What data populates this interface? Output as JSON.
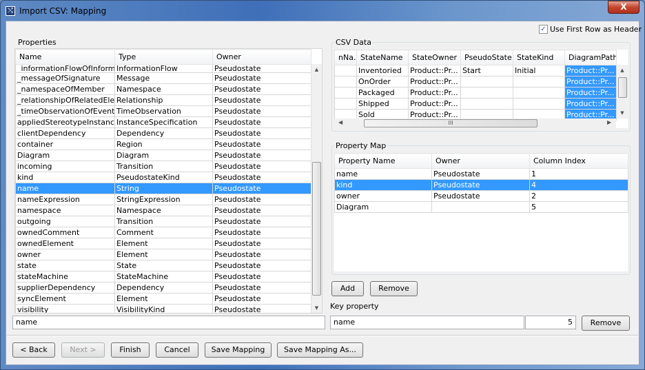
{
  "window": {
    "title": "Import CSV: Mapping",
    "close_label": "X"
  },
  "use_first_row": {
    "label": "Use First Row as Header",
    "checked": true
  },
  "properties": {
    "title": "Properties",
    "columns": [
      "Name",
      "Type",
      "Owner"
    ],
    "rows": [
      [
        "_informationFlowOfInform...",
        "InformationFlow",
        "Pseudostate"
      ],
      [
        "_messageOfSignature",
        "Message",
        "Pseudostate"
      ],
      [
        "_namespaceOfMember",
        "Namespace",
        "Pseudostate"
      ],
      [
        "_relationshipOfRelatedEle...",
        "Relationship",
        "Pseudostate"
      ],
      [
        "_timeObservationOfEvent",
        "TimeObservation",
        "Pseudostate"
      ],
      [
        "appliedStereotypeInstance",
        "InstanceSpecification",
        "Pseudostate"
      ],
      [
        "clientDependency",
        "Dependency",
        "Pseudostate"
      ],
      [
        "container",
        "Region",
        "Pseudostate"
      ],
      [
        "Diagram",
        "Diagram",
        "Pseudostate"
      ],
      [
        "incoming",
        "Transition",
        "Pseudostate"
      ],
      [
        "kind",
        "PseudostateKind",
        "Pseudostate"
      ],
      [
        "name",
        "String",
        "Pseudostate"
      ],
      [
        "nameExpression",
        "StringExpression",
        "Pseudostate"
      ],
      [
        "namespace",
        "Namespace",
        "Pseudostate"
      ],
      [
        "outgoing",
        "Transition",
        "Pseudostate"
      ],
      [
        "ownedComment",
        "Comment",
        "Pseudostate"
      ],
      [
        "ownedElement",
        "Element",
        "Pseudostate"
      ],
      [
        "owner",
        "Element",
        "Pseudostate"
      ],
      [
        "state",
        "State",
        "Pseudostate"
      ],
      [
        "stateMachine",
        "StateMachine",
        "Pseudostate"
      ],
      [
        "supplierDependency",
        "Dependency",
        "Pseudostate"
      ],
      [
        "syncElement",
        "Element",
        "Pseudostate"
      ],
      [
        "visibility",
        "VisibilityKind",
        "Pseudostate"
      ]
    ],
    "selected_index": 11,
    "filter_value": "name"
  },
  "csv": {
    "title": "CSV Data",
    "columns": [
      "nNa...",
      "StateName",
      "StateOwner",
      "PseudoState",
      "StateKind",
      "DiagramPath"
    ],
    "rows": [
      [
        "",
        "Inventoried",
        "Product::Pr...",
        "Start",
        "Initial",
        "Product::Pr..."
      ],
      [
        "",
        "OnOrder",
        "Product::Pr...",
        "",
        "",
        "Product::Pr..."
      ],
      [
        "",
        "Packaged",
        "Product::Pr...",
        "",
        "",
        "Product::Pr..."
      ],
      [
        "",
        "Shipped",
        "Product::Pr...",
        "",
        "",
        "Product::Pr..."
      ],
      [
        "",
        "Sold",
        "Product::Pr...",
        "",
        "",
        "Product::Pr..."
      ]
    ],
    "highlighted_column": 5,
    "hscroll_grip": "III"
  },
  "property_map": {
    "title": "Property Map",
    "columns": [
      "Property Name",
      "Owner",
      "Column Index"
    ],
    "rows": [
      [
        "name",
        "Pseudostate",
        "1"
      ],
      [
        "kind",
        "Pseudostate",
        "4"
      ],
      [
        "owner",
        "Pseudostate",
        "2"
      ],
      [
        "Diagram",
        "",
        "5"
      ]
    ],
    "selected_index": 1
  },
  "map_buttons": {
    "add": "Add",
    "remove": "Remove"
  },
  "key_property": {
    "label": "Key property",
    "name": "name",
    "index": "5",
    "remove": "Remove"
  },
  "footer": {
    "back": "< Back",
    "next": "Next >",
    "finish": "Finish",
    "cancel": "Cancel",
    "save": "Save Mapping",
    "save_as": "Save Mapping As..."
  }
}
